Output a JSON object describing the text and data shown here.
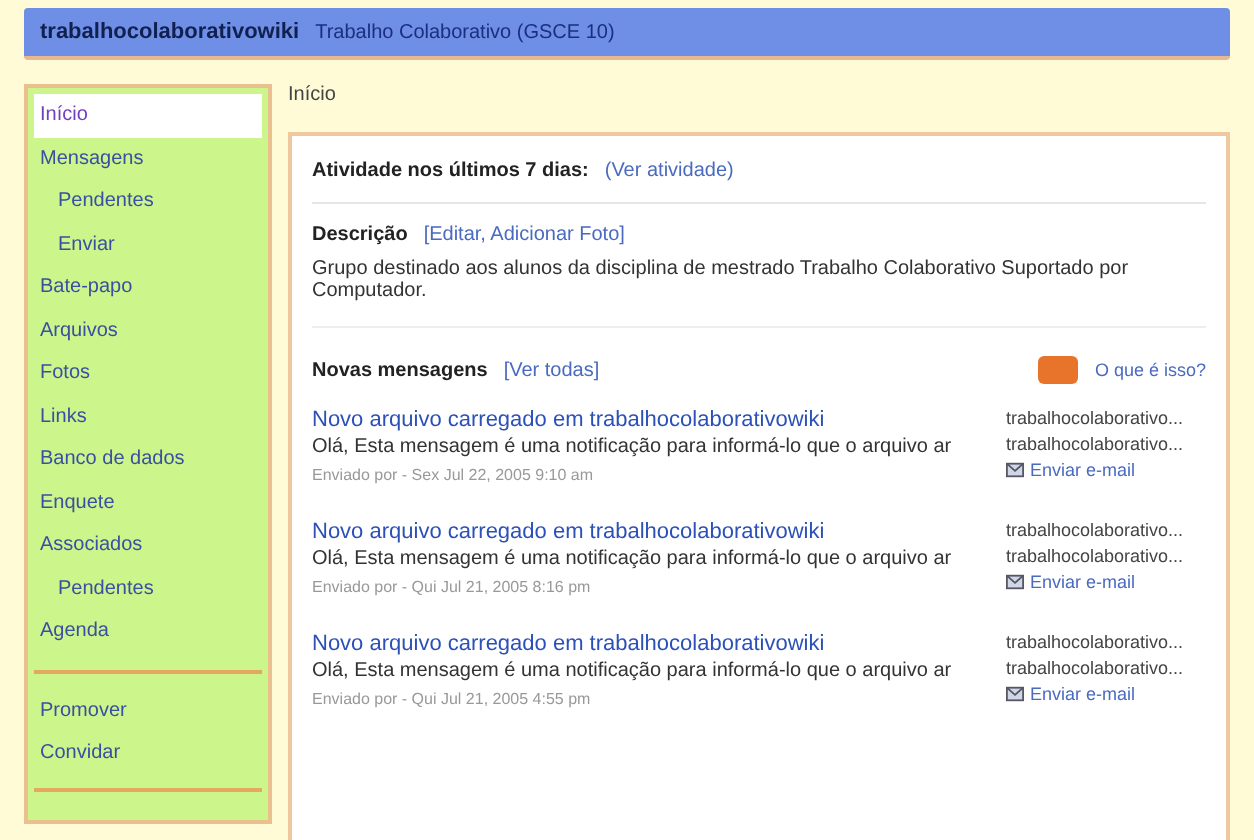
{
  "header": {
    "group_name": "trabalhocolaborativowiki",
    "subtitle": "Trabalho Colaborativo (GSCE 10)"
  },
  "sidebar": {
    "items": [
      {
        "label": "Início",
        "selected": true
      },
      {
        "label": "Mensagens",
        "selected": false,
        "children": [
          {
            "label": "Pendentes",
            "selected": false
          },
          {
            "label": "Enviar",
            "selected": false
          }
        ]
      },
      {
        "label": "Bate-papo",
        "selected": false
      },
      {
        "label": "Arquivos",
        "selected": false
      },
      {
        "label": "Fotos",
        "selected": false
      },
      {
        "label": "Links",
        "selected": false
      },
      {
        "label": "Banco de dados",
        "selected": false
      },
      {
        "label": "Enquete",
        "selected": false
      },
      {
        "label": "Associados",
        "selected": false,
        "children": [
          {
            "label": "Pendentes",
            "selected": false
          }
        ]
      },
      {
        "label": "Agenda",
        "selected": false
      }
    ],
    "extra_items": [
      {
        "label": "Promover"
      },
      {
        "label": "Convidar"
      }
    ]
  },
  "breadcrumb": "Início",
  "activity": {
    "label": "Atividade nos últimos 7 dias:",
    "link": "(Ver atividade)"
  },
  "description": {
    "label": "Descrição",
    "link": "[Editar, Adicionar Foto]",
    "text": "Grupo destinado aos alunos da disciplina de mestrado Trabalho Colaborativo Suportado por Computador."
  },
  "messages": {
    "label": "Novas mensagens",
    "link": "[Ver todas]",
    "rss_link": "O que é isso?",
    "items": [
      {
        "subject": "Novo arquivo carregado em trabalhocolaborativowiki",
        "snippet": "Olá, Esta mensagem é uma notificação para informá-lo que o arquivo ar",
        "meta": "Enviado por - Sex Jul 22, 2005 9:10 am",
        "author": "trabalhocolaborativo...",
        "author_2": "trabalhocolaborativo...",
        "mail": "Enviar e-mail"
      },
      {
        "subject": "Novo arquivo carregado em trabalhocolaborativowiki",
        "snippet": "Olá, Esta mensagem é uma notificação para informá-lo que o arquivo ar",
        "meta": "Enviado por - Qui Jul 21, 2005 8:16 pm",
        "author": "trabalhocolaborativo...",
        "author_2": "trabalhocolaborativo...",
        "mail": "Enviar e-mail"
      },
      {
        "subject": "Novo arquivo carregado em trabalhocolaborativowiki",
        "snippet": "Olá, Esta mensagem é uma notificação para informá-lo que o arquivo ar",
        "meta": "Enviado por - Qui Jul 21, 2005 4:55 pm",
        "author": "trabalhocolaborativo...",
        "author_2": "trabalhocolaborativo...",
        "mail": "Enviar e-mail"
      }
    ]
  }
}
